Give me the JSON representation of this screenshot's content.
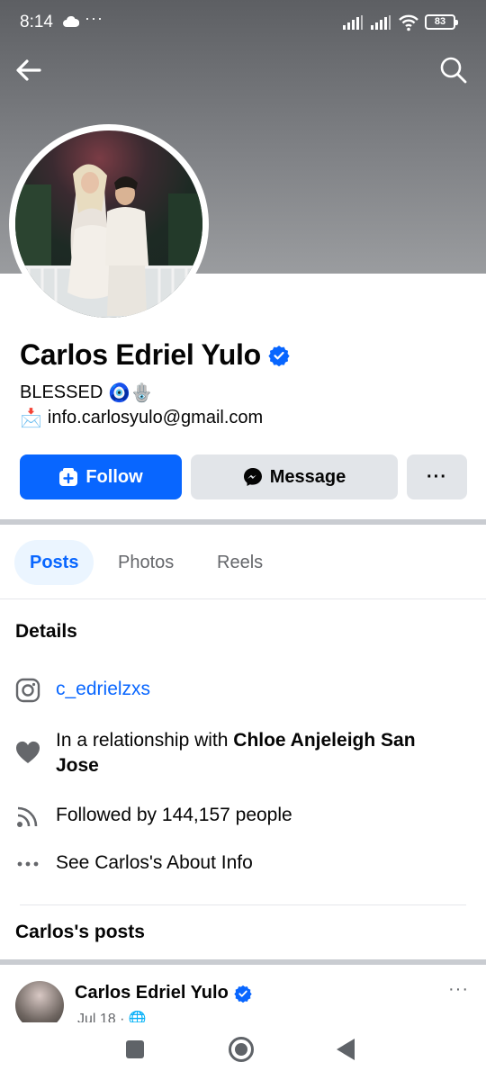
{
  "status_bar": {
    "time": "8:14",
    "dots": "···",
    "battery": "83"
  },
  "profile": {
    "name": "Carlos Edriel Yulo",
    "bio_line1": "BLESSED",
    "bio_emojis": "🧿🪬",
    "bio_line2_icon": "📩",
    "email": "info.carlosyulo@gmail.com"
  },
  "actions": {
    "follow_label": "Follow",
    "message_label": "Message",
    "more_label": "···"
  },
  "tabs": [
    {
      "label": "Posts",
      "active": true
    },
    {
      "label": "Photos",
      "active": false
    },
    {
      "label": "Reels",
      "active": false
    }
  ],
  "details": {
    "title": "Details",
    "instagram": "c_edrielzxs",
    "relationship_prefix": "In a relationship with ",
    "relationship_name": "Chloe Anjeleigh San Jose",
    "followed_by": "Followed by 144,157 people",
    "about": "See Carlos's About Info"
  },
  "posts_section": {
    "title": "Carlos's posts",
    "author": "Carlos Edriel Yulo",
    "date": "Jul 18 · 🌐",
    "more": "···"
  },
  "colors": {
    "brand_blue": "#0866ff",
    "button_gray": "#e2e5e9",
    "tab_active_bg": "#ebf5ff"
  }
}
